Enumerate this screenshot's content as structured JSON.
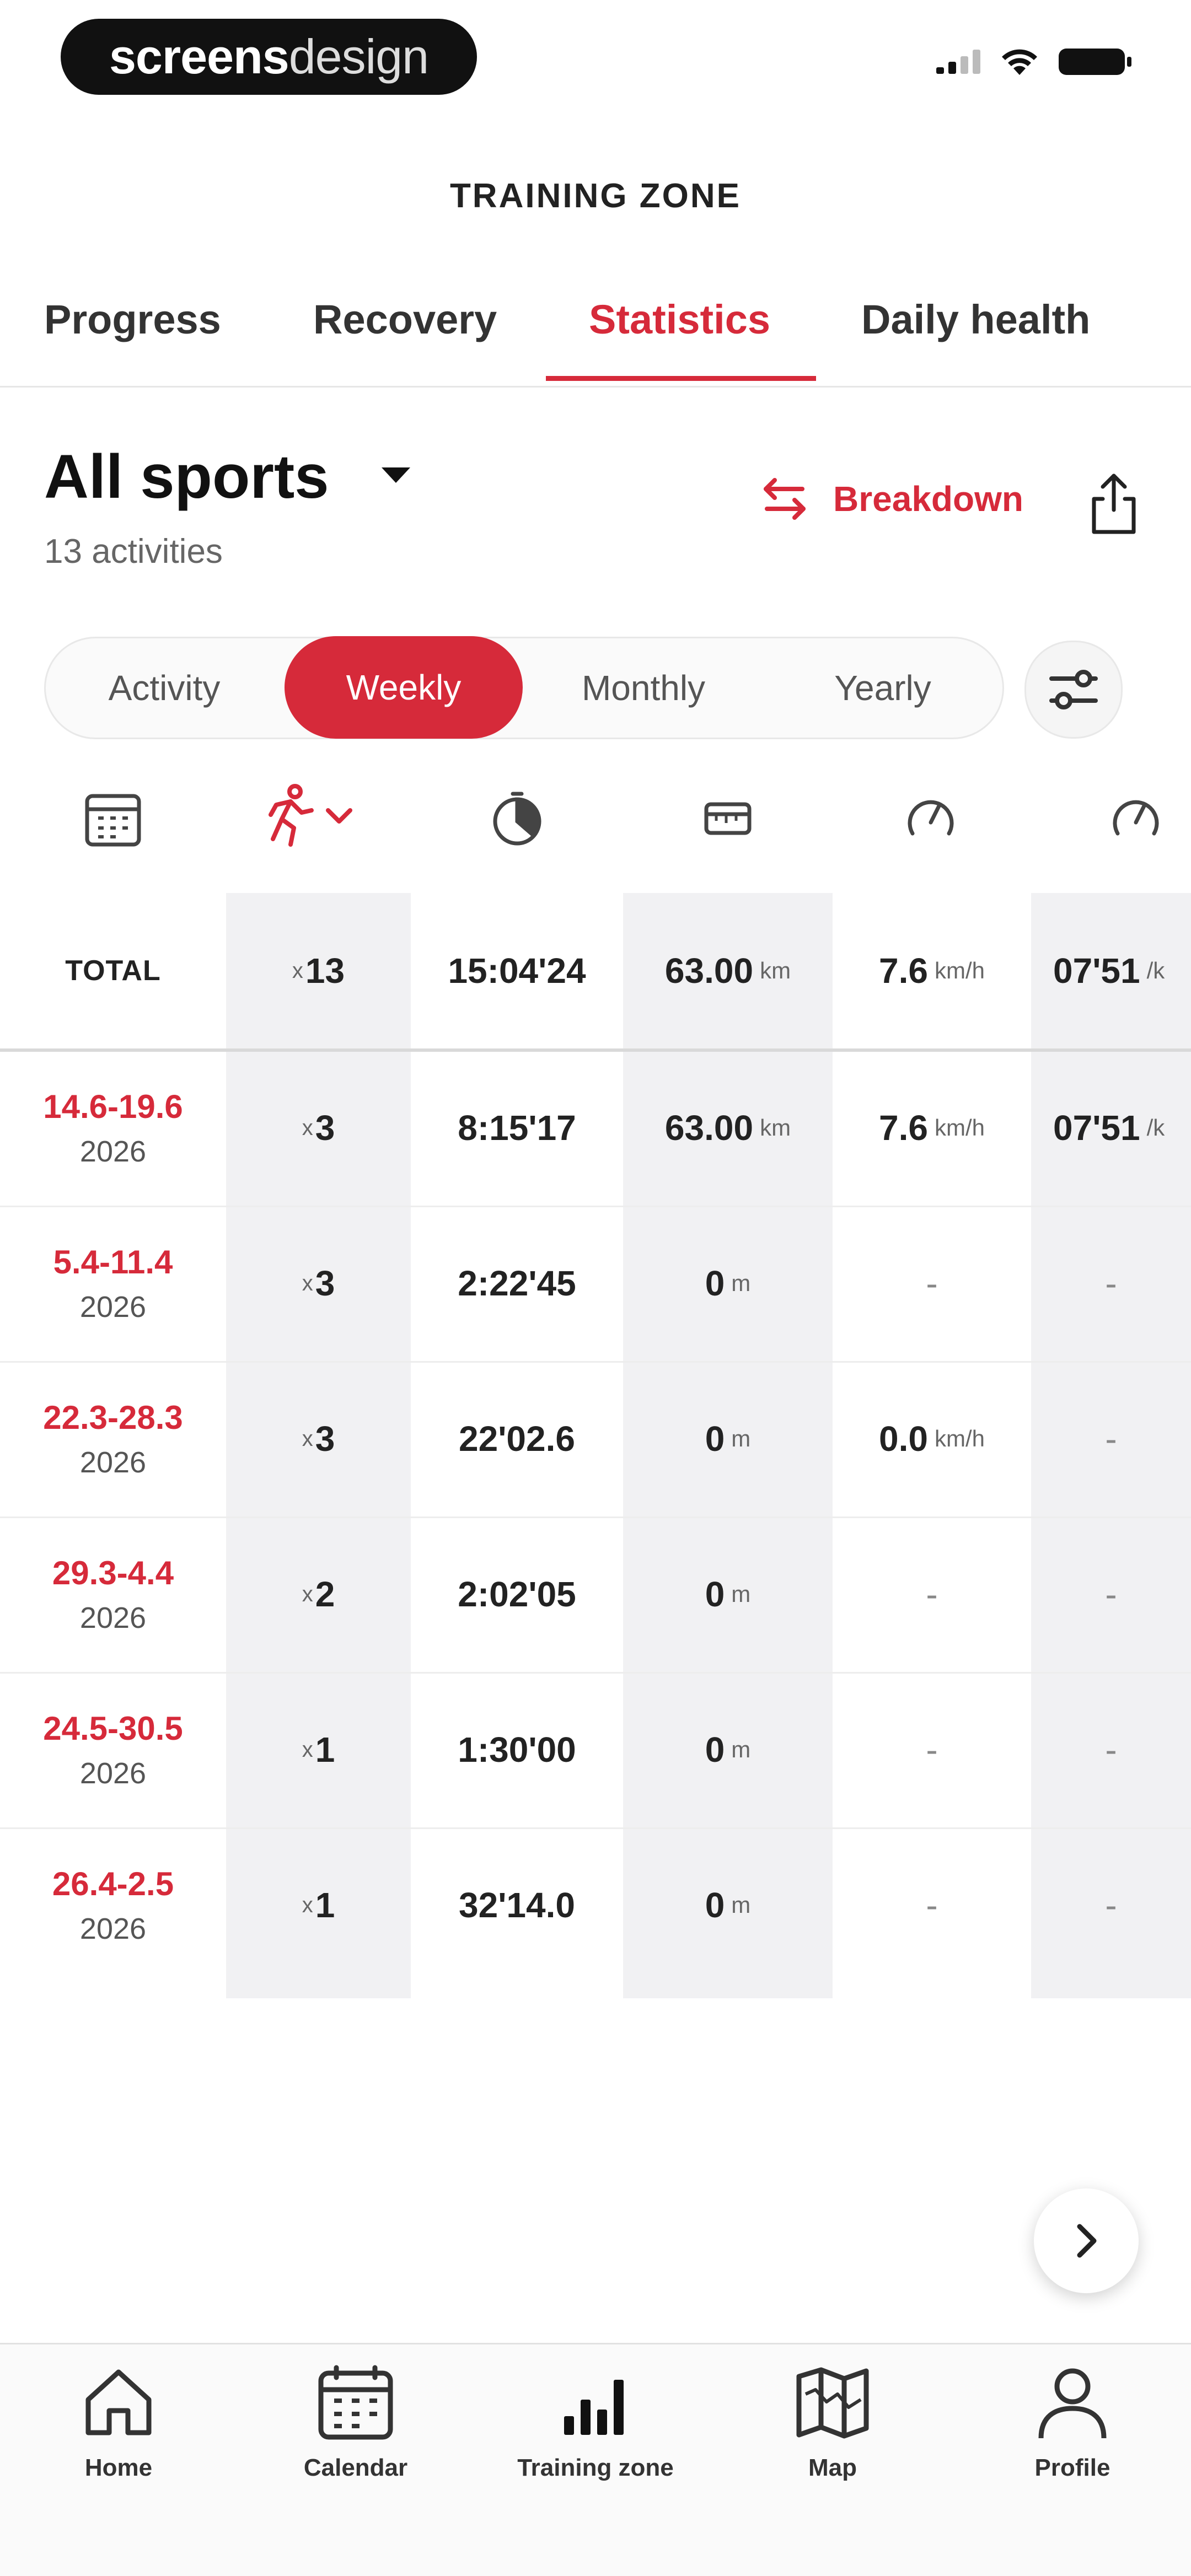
{
  "status_bar": {
    "brand_bold": "screens",
    "brand_light": "design"
  },
  "header": {
    "title": "TRAINING ZONE"
  },
  "tabs": [
    {
      "label": "Progress",
      "active": false
    },
    {
      "label": "Recovery",
      "active": false
    },
    {
      "label": "Statistics",
      "active": true
    },
    {
      "label": "Daily health",
      "active": false
    }
  ],
  "sport_filter": {
    "label": "All sports",
    "activities_count": "13 activities"
  },
  "breakdown": {
    "label": "Breakdown"
  },
  "periods": [
    {
      "label": "Activity",
      "active": false
    },
    {
      "label": "Weekly",
      "active": true
    },
    {
      "label": "Monthly",
      "active": false
    },
    {
      "label": "Yearly",
      "active": false
    }
  ],
  "columns_icons": [
    "calendar-icon",
    "running-icon",
    "duration-icon",
    "distance-icon",
    "speed-icon",
    "pace-icon"
  ],
  "table": {
    "total": {
      "label": "TOTAL",
      "count": "13",
      "duration": "15:04'24",
      "distance": "63.00",
      "distance_unit": "km",
      "speed": "7.6",
      "speed_unit": "km/h",
      "pace": "07'51",
      "pace_unit": "/k"
    },
    "rows": [
      {
        "range": "14.6-19.6",
        "year": "2026",
        "count": "3",
        "duration": "8:15'17",
        "distance": "63.00",
        "distance_unit": "km",
        "speed": "7.6",
        "speed_unit": "km/h",
        "pace": "07'51",
        "pace_unit": "/k"
      },
      {
        "range": "5.4-11.4",
        "year": "2026",
        "count": "3",
        "duration": "2:22'45",
        "distance": "0",
        "distance_unit": "m",
        "speed": "-",
        "speed_unit": "",
        "pace": "-",
        "pace_unit": ""
      },
      {
        "range": "22.3-28.3",
        "year": "2026",
        "count": "3",
        "duration": "22'02.6",
        "distance": "0",
        "distance_unit": "m",
        "speed": "0.0",
        "speed_unit": "km/h",
        "pace": "-",
        "pace_unit": ""
      },
      {
        "range": "29.3-4.4",
        "year": "2026",
        "count": "2",
        "duration": "2:02'05",
        "distance": "0",
        "distance_unit": "m",
        "speed": "-",
        "speed_unit": "",
        "pace": "-",
        "pace_unit": ""
      },
      {
        "range": "24.5-30.5",
        "year": "2026",
        "count": "1",
        "duration": "1:30'00",
        "distance": "0",
        "distance_unit": "m",
        "speed": "-",
        "speed_unit": "",
        "pace": "-",
        "pace_unit": ""
      },
      {
        "range": "26.4-2.5",
        "year": "2026",
        "count": "1",
        "duration": "32'14.0",
        "distance": "0",
        "distance_unit": "m",
        "speed": "-",
        "speed_unit": "",
        "pace": "-",
        "pace_unit": ""
      }
    ]
  },
  "bottom_nav": [
    {
      "label": "Home",
      "icon": "home-icon",
      "active": false
    },
    {
      "label": "Calendar",
      "icon": "calendar-icon",
      "active": false
    },
    {
      "label": "Training zone",
      "icon": "bar-chart-icon",
      "active": true
    },
    {
      "label": "Map",
      "icon": "map-icon",
      "active": false
    },
    {
      "label": "Profile",
      "icon": "profile-icon",
      "active": false
    }
  ],
  "colors": {
    "accent": "#d62a3a",
    "text": "#222222",
    "muted": "#666666",
    "column_shade": "#f1f1f3"
  }
}
